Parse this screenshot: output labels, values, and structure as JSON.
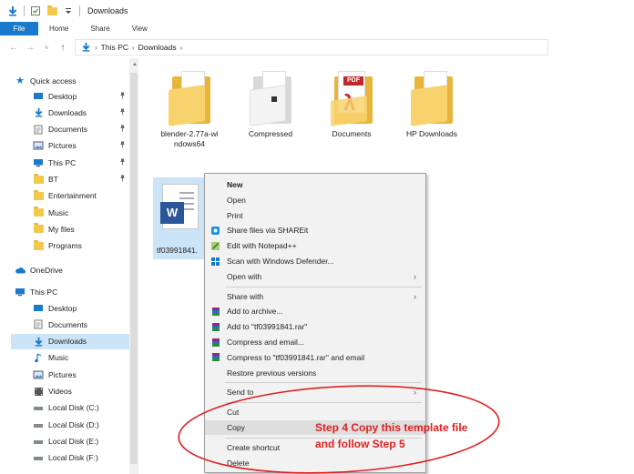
{
  "window": {
    "title": "Downloads"
  },
  "ribbon": {
    "tabs": [
      "File",
      "Home",
      "Share",
      "View"
    ]
  },
  "address": {
    "crumbs": [
      "This PC",
      "Downloads"
    ]
  },
  "sidebar": {
    "quick_access": "Quick access",
    "quick_items": [
      {
        "label": "Desktop",
        "icon": "desktop-icon",
        "pinned": true
      },
      {
        "label": "Downloads",
        "icon": "download-icon",
        "pinned": true
      },
      {
        "label": "Documents",
        "icon": "documents-icon",
        "pinned": true
      },
      {
        "label": "Pictures",
        "icon": "pictures-icon",
        "pinned": true
      },
      {
        "label": "This PC",
        "icon": "computer-icon",
        "pinned": true
      },
      {
        "label": "BT",
        "icon": "folder-icon",
        "pinned": true
      },
      {
        "label": "Entertainment",
        "icon": "folder-icon",
        "pinned": false
      },
      {
        "label": "Music",
        "icon": "folder-icon",
        "pinned": false
      },
      {
        "label": "My files",
        "icon": "folder-icon",
        "pinned": false
      },
      {
        "label": "Programs",
        "icon": "folder-icon",
        "pinned": false
      }
    ],
    "onedrive": "OneDrive",
    "this_pc": "This PC",
    "pc_items": [
      {
        "label": "Desktop",
        "icon": "desktop-icon"
      },
      {
        "label": "Documents",
        "icon": "documents-icon"
      },
      {
        "label": "Downloads",
        "icon": "download-icon",
        "selected": true
      },
      {
        "label": "Music",
        "icon": "music-icon"
      },
      {
        "label": "Pictures",
        "icon": "pictures-icon"
      },
      {
        "label": "Videos",
        "icon": "videos-icon"
      },
      {
        "label": "Local Disk (C:)",
        "icon": "drive-icon"
      },
      {
        "label": "Local Disk (D:)",
        "icon": "drive-icon"
      },
      {
        "label": "Local Disk (E:)",
        "icon": "drive-icon"
      },
      {
        "label": "Local Disk (F:)",
        "icon": "drive-icon"
      }
    ]
  },
  "files": [
    {
      "label_line1": "blender-2.77a-wi",
      "label_line2": "ndows64",
      "kind": "folder"
    },
    {
      "label_line1": "Compressed",
      "label_line2": "",
      "kind": "folder-white"
    },
    {
      "label_line1": "Documents",
      "label_line2": "",
      "kind": "folder-pdf",
      "badge": "PDF"
    },
    {
      "label_line1": "HP Downloads",
      "label_line2": "",
      "kind": "folder"
    }
  ],
  "selected_file": {
    "label": "tf03991841.",
    "icon_letter": "W"
  },
  "context_menu": [
    {
      "label": "New",
      "bold": true
    },
    {
      "label": "Open"
    },
    {
      "label": "Print"
    },
    {
      "label": "Share files via SHAREit",
      "icon": "shareit-icon"
    },
    {
      "label": "Edit with Notepad++",
      "icon": "notepad-icon"
    },
    {
      "label": "Scan with Windows Defender...",
      "icon": "defender-icon"
    },
    {
      "label": "Open with",
      "submenu": true
    },
    {
      "label": "Share with",
      "submenu": true
    },
    {
      "label": "Add to archive...",
      "icon": "winrar-icon"
    },
    {
      "label": "Add to \"tf03991841.rar\"",
      "icon": "winrar-icon"
    },
    {
      "label": "Compress and email...",
      "icon": "winrar-icon"
    },
    {
      "label": "Compress to \"tf03991841.rar\" and email",
      "icon": "winrar-icon"
    },
    {
      "label": "Restore previous versions"
    },
    {
      "label": "Send to",
      "submenu": true
    },
    {
      "label": "Cut"
    },
    {
      "label": "Copy",
      "hover": true
    },
    {
      "label": "Create shortcut"
    },
    {
      "label": "Delete"
    }
  ],
  "annotation": {
    "line1": "Step 4 Copy this template file",
    "line2": "and follow Step 5",
    "color": "#e02020"
  },
  "colors": {
    "accent": "#1979ca",
    "selection": "#cce4f7",
    "folder": "#f8d26c"
  }
}
